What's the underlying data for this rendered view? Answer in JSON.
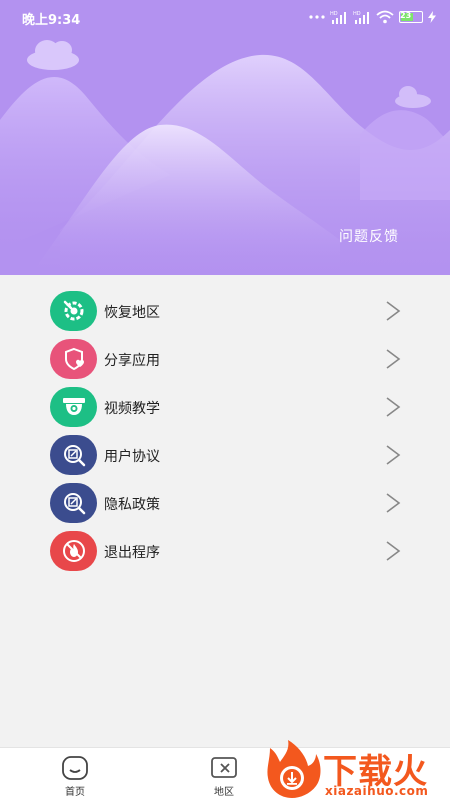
{
  "status_bar": {
    "time": "晚上9:34",
    "signal_label_1": "HD",
    "signal_label_2": "HD",
    "battery_level": "23",
    "icons": [
      "dots-icon",
      "signal-icon",
      "signal-icon",
      "wifi-icon",
      "battery-icon",
      "charging-icon"
    ]
  },
  "header": {
    "feedback_label": "问题反馈",
    "background_color": "#b392f0"
  },
  "menu": {
    "items": [
      {
        "label": "恢复地区",
        "icon": "restore-icon",
        "color": "#1dbf85"
      },
      {
        "label": "分享应用",
        "icon": "share-heart-icon",
        "color": "#e8537a"
      },
      {
        "label": "视频教学",
        "icon": "camera-icon",
        "color": "#1dbf85"
      },
      {
        "label": "用户协议",
        "icon": "agreement-search-icon",
        "color": "#3b4c8e"
      },
      {
        "label": "隐私政策",
        "icon": "privacy-search-icon",
        "color": "#3b4c8e"
      },
      {
        "label": "退出程序",
        "icon": "exit-fire-icon",
        "color": "#e8474a"
      }
    ]
  },
  "tabbar": {
    "tabs": [
      {
        "label": "首页",
        "icon": "home-icon"
      },
      {
        "label": "地区",
        "icon": "region-icon"
      }
    ]
  },
  "watermark": {
    "brand": "下载火",
    "url": "xiazaihuo.com",
    "color": "#f3581e"
  }
}
